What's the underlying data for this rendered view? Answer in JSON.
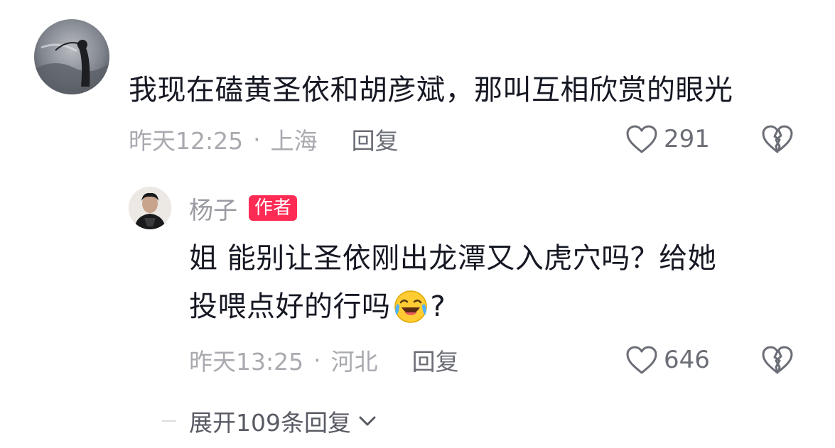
{
  "comment": {
    "text": "我现在磕黄圣依和胡彦斌，那叫互相欣赏的眼光",
    "time": "昨天12:25",
    "location": "上海",
    "separator": "·",
    "reply_label": "回复",
    "like_count": "291"
  },
  "reply": {
    "username": "杨子",
    "badge": "作者",
    "text_line1": "姐 能别让圣依刚出龙潭又入虎穴吗？给她",
    "text_line2": "投喂点好的行吗",
    "text_suffix": "?",
    "time": "昨天13:25",
    "location": "河北",
    "separator": "·",
    "reply_label": "回复",
    "like_count": "646"
  },
  "expand": {
    "label": "展开109条回复"
  },
  "icons": {
    "like": "heart-outline-icon",
    "dislike": "broken-heart-icon",
    "emoji": "laughing-crying-emoji-icon",
    "expand": "chevron-down-icon"
  },
  "colors": {
    "badge": "#fe2c55",
    "meta": "#a9aab0",
    "text": "#161823"
  }
}
